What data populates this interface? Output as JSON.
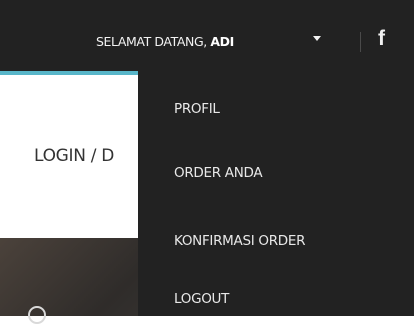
{
  "header": {
    "welcome_prefix": "SELAMAT DATANG, ",
    "user_name": "ADI",
    "social_icon": "facebook-icon",
    "social_glyph": "f",
    "background_color": "#222222",
    "accent_color": "#58b6c9"
  },
  "page": {
    "breadcrumb": "LOGIN / D"
  },
  "user_menu": {
    "items": [
      {
        "label": "PROFIL"
      },
      {
        "label": "ORDER ANDA"
      },
      {
        "label": "KONFIRMASI ORDER"
      },
      {
        "label": "LOGOUT"
      }
    ]
  }
}
